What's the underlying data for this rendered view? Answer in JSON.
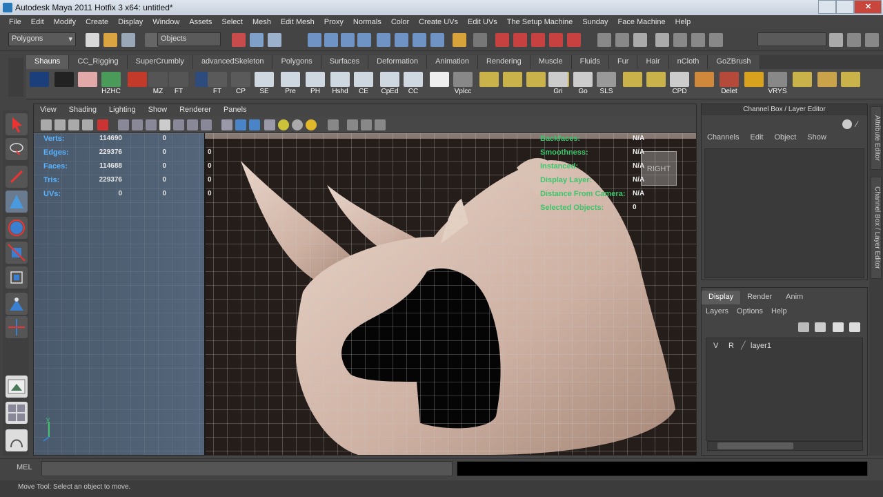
{
  "window": {
    "title": "Autodesk Maya 2011 Hotfix 3 x64: untitled*"
  },
  "menu": {
    "items": [
      "File",
      "Edit",
      "Modify",
      "Create",
      "Display",
      "Window",
      "Assets",
      "Select",
      "Mesh",
      "Edit Mesh",
      "Proxy",
      "Normals",
      "Color",
      "Create UVs",
      "Edit UVs",
      "The Setup Machine",
      "Sunday",
      "Face Machine",
      "Help"
    ]
  },
  "statusline": {
    "mode": "Polygons",
    "selection_field": "Objects"
  },
  "shelf": {
    "tabs": [
      "Shauns",
      "CC_Rigging",
      "SuperCrumbly",
      "advancedSkeleton",
      "Polygons",
      "Surfaces",
      "Deformation",
      "Animation",
      "Rendering",
      "Muscle",
      "Fluids",
      "Fur",
      "Hair",
      "nCloth",
      "GoZBrush"
    ],
    "active_tab": "Shauns",
    "icons": [
      "",
      "",
      "",
      "HZHC",
      "",
      "MZ",
      "FT",
      "",
      "FT",
      "CP",
      "SE",
      "Pre",
      "PH",
      "Hshd",
      "CE",
      "CpEd",
      "CC",
      "",
      "Vplcc",
      "",
      "",
      "",
      "",
      "Gri",
      "Go",
      "SLS",
      "",
      "",
      "CPD",
      "",
      "Delet",
      "",
      "VRYS",
      "",
      "",
      ""
    ]
  },
  "viewport": {
    "menu": [
      "View",
      "Shading",
      "Lighting",
      "Show",
      "Renderer",
      "Panels"
    ],
    "hud_left": [
      {
        "label": "Verts:",
        "v1": "114690",
        "v2": "0",
        "v3": ""
      },
      {
        "label": "Edges:",
        "v1": "229376",
        "v2": "0",
        "v3": "0"
      },
      {
        "label": "Faces:",
        "v1": "114688",
        "v2": "0",
        "v3": "0"
      },
      {
        "label": "Tris:",
        "v1": "229376",
        "v2": "0",
        "v3": "0"
      },
      {
        "label": "UVs:",
        "v1": "0",
        "v2": "0",
        "v3": "0"
      }
    ],
    "hud_right": [
      {
        "label": "Backfaces:",
        "value": "N/A"
      },
      {
        "label": "Smoothness:",
        "value": "N/A"
      },
      {
        "label": "Instanced:",
        "value": "N/A"
      },
      {
        "label": "Display Layer:",
        "value": "N/A"
      },
      {
        "label": "Distance From Camera:",
        "value": "N/A"
      },
      {
        "label": "Selected Objects:",
        "value": "0"
      }
    ],
    "cube_label": "RIGHT"
  },
  "channel_box": {
    "title": "Channel Box / Layer Editor",
    "menu": [
      "Channels",
      "Edit",
      "Object",
      "Show"
    ]
  },
  "side_tabs": [
    "Attribute Editor",
    "Channel Box / Layer Editor"
  ],
  "layer_editor": {
    "tabs": [
      "Display",
      "Render",
      "Anim"
    ],
    "active_tab": "Display",
    "menu": [
      "Layers",
      "Options",
      "Help"
    ],
    "layers": [
      {
        "v": "V",
        "r": "R",
        "name": "layer1"
      }
    ]
  },
  "mel": {
    "label": "MEL"
  },
  "help_line": {
    "text": "Move Tool: Select an object to move."
  },
  "colors": {
    "hud_blue": "#5ab3ff",
    "hud_green": "#3ec46d",
    "maya_gray": "#444444"
  }
}
